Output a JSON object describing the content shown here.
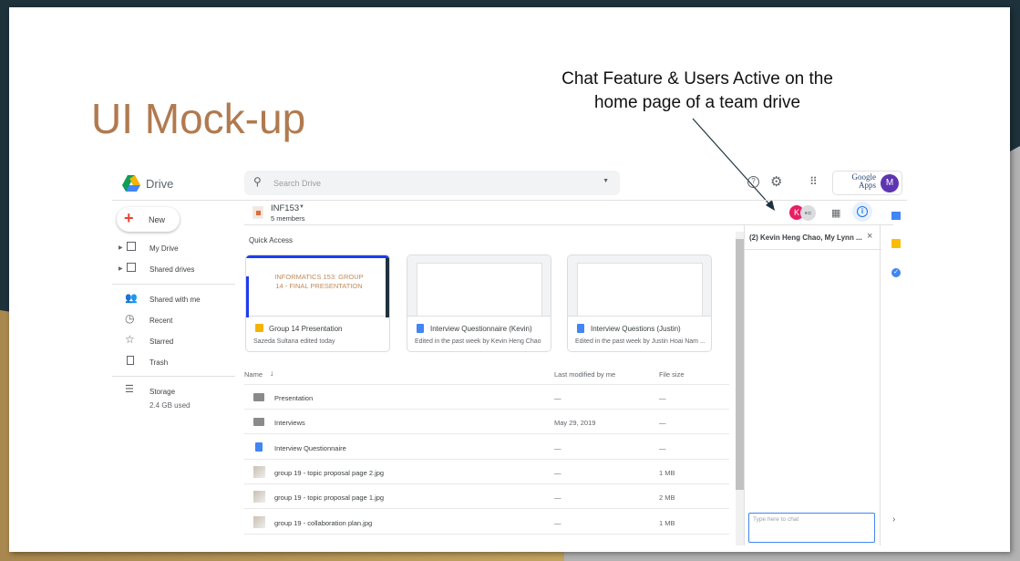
{
  "slide": {
    "title": "UI Mock-up",
    "annotation_line1": "Chat Feature & Users Active on the",
    "annotation_line2": "home page of a team drive"
  },
  "drive": {
    "logo_text": "Drive",
    "search_placeholder": "Search Drive",
    "apps_logo_text": "Google Apps",
    "account_initial": "M",
    "team_drive": {
      "name": "INF153",
      "members": "5 members"
    },
    "new_label": "New",
    "sidebar": [
      {
        "label": "My Drive",
        "icon": "my-drive-icon"
      },
      {
        "label": "Shared drives",
        "icon": "shared-drives-icon"
      },
      {
        "label": "Shared with me",
        "icon": "people-icon"
      },
      {
        "label": "Recent",
        "icon": "clock-icon"
      },
      {
        "label": "Starred",
        "icon": "star-icon"
      },
      {
        "label": "Trash",
        "icon": "trash-icon"
      }
    ],
    "storage": {
      "label": "Storage",
      "used": "2.4 GB used"
    },
    "quick_access": {
      "heading": "Quick Access",
      "cards": [
        {
          "title": "Group 14 Presentation",
          "subtitle": "Sazeda Sultana edited today",
          "type": "slides",
          "thumb_title": "INFORMATICS 153: GROUP 14 - FINAL PRESENTATION"
        },
        {
          "title": "Interview Questionnaire (Kevin)",
          "subtitle": "Edited in the past week by Kevin Heng Chao",
          "type": "doc"
        },
        {
          "title": "Interview Questions (Justin)",
          "subtitle": "Edited in the past week by Justin Hoai Nam ...",
          "type": "doc"
        }
      ]
    },
    "table": {
      "headers": {
        "name": "Name",
        "modified": "Last modified by me",
        "size": "File size"
      },
      "rows": [
        {
          "name": "Presentation",
          "type": "folder",
          "modified": "—",
          "size": "—"
        },
        {
          "name": "Interviews",
          "type": "folder",
          "modified": "May 29, 2019",
          "size": "—"
        },
        {
          "name": "Interview Questionnaire",
          "type": "doc",
          "modified": "—",
          "size": "—"
        },
        {
          "name": "group 19 - topic proposal page 2.jpg",
          "type": "image",
          "modified": "—",
          "size": "1 MB"
        },
        {
          "name": "group 19 - topic proposal page 1.jpg",
          "type": "image",
          "modified": "—",
          "size": "2 MB"
        },
        {
          "name": "group 19 - collaboration plan.jpg",
          "type": "image",
          "modified": "—",
          "size": "1 MB"
        }
      ]
    },
    "active_user_initial": "K",
    "chat": {
      "title": "(2) Kevin Heng Chao, My Lynn ...",
      "input_placeholder": "Type here to chat"
    },
    "colors": {
      "blue": "#1a73e8",
      "purple": "#5e35b1",
      "pink": "#e91e63"
    }
  }
}
